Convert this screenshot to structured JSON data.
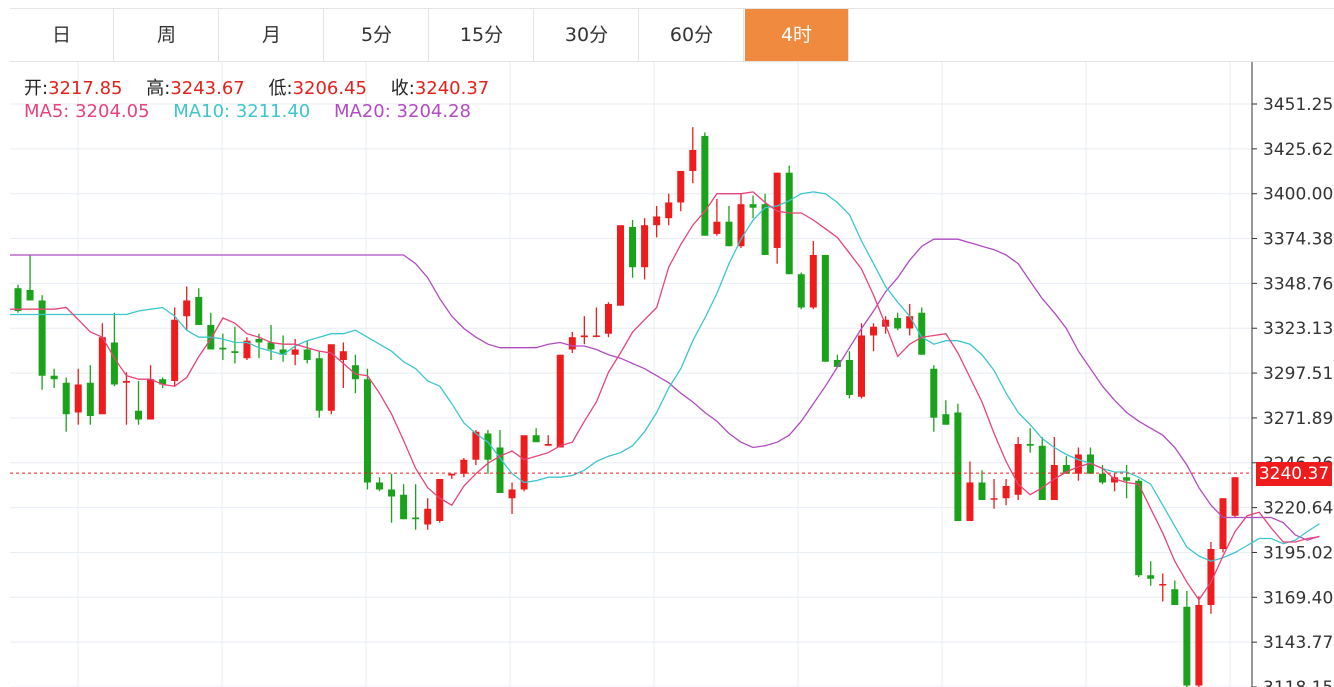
{
  "tabs": [
    {
      "label": "日",
      "active": false
    },
    {
      "label": "周",
      "active": false
    },
    {
      "label": "月",
      "active": false
    },
    {
      "label": "5分",
      "active": false
    },
    {
      "label": "15分",
      "active": false
    },
    {
      "label": "30分",
      "active": false
    },
    {
      "label": "60分",
      "active": false
    },
    {
      "label": "4时",
      "active": true
    }
  ],
  "ohlc": {
    "open_label": "开:",
    "open": "3217.85",
    "high_label": "高:",
    "high": "3243.67",
    "low_label": "低:",
    "low": "3206.45",
    "close_label": "收:",
    "close": "3240.37"
  },
  "ma": {
    "ma5_label": "MA5:",
    "ma5": "3204.05",
    "ma10_label": "MA10:",
    "ma10": "3211.40",
    "ma20_label": "MA20:",
    "ma20": "3204.28"
  },
  "colors": {
    "up": "#ee1c1c",
    "down": "#1aa31a",
    "ma5": "#e8447a",
    "ma10": "#3ec6cf",
    "ma20": "#b24bc3",
    "accent": "#f08a3e"
  },
  "chart_data": {
    "type": "candlestick",
    "y_ticks": [
      3451.25,
      3425.62,
      3400.0,
      3374.38,
      3348.76,
      3323.13,
      3297.51,
      3271.89,
      3246.26,
      3220.64,
      3195.02,
      3169.4,
      3143.77,
      3118.15
    ],
    "y_tick_labels": [
      "3451.25",
      "3425.62",
      "3400.00",
      "3374.38",
      "3348.76",
      "3323.13",
      "3297.51",
      "3271.89",
      "3246.26",
      "3220.64",
      "3195.02",
      "3169.40",
      "3143.77",
      "3118.15"
    ],
    "ylim": [
      3115,
      3475
    ],
    "current_price": 3240.37,
    "current_price_label": "3240.37",
    "candles": [
      [
        3346,
        3348,
        3332,
        3333
      ],
      [
        3345,
        3365,
        3345,
        3339
      ],
      [
        3339,
        3342,
        3288,
        3296
      ],
      [
        3296,
        3300,
        3289,
        3294
      ],
      [
        3292,
        3295,
        3264,
        3274
      ],
      [
        3275,
        3300,
        3268,
        3291
      ],
      [
        3292,
        3302,
        3268,
        3273
      ],
      [
        3274,
        3326,
        3274,
        3318
      ],
      [
        3315,
        3332,
        3290,
        3291
      ],
      [
        3292,
        3298,
        3268,
        3293
      ],
      [
        3276,
        3293,
        3268,
        3271
      ],
      [
        3271,
        3302,
        3271,
        3294
      ],
      [
        3294,
        3295,
        3289,
        3291
      ],
      [
        3293,
        3335,
        3290,
        3328
      ],
      [
        3330,
        3347,
        3322,
        3339
      ],
      [
        3341,
        3346,
        3326,
        3325
      ],
      [
        3325,
        3332,
        3312,
        3311
      ],
      [
        3312,
        3320,
        3305,
        3311
      ],
      [
        3310,
        3324,
        3303,
        3309
      ],
      [
        3306,
        3318,
        3305,
        3316
      ],
      [
        3317,
        3320,
        3306,
        3315
      ],
      [
        3315,
        3325,
        3305,
        3311
      ],
      [
        3311,
        3319,
        3304,
        3308
      ],
      [
        3308,
        3317,
        3302,
        3311
      ],
      [
        3311,
        3316,
        3303,
        3305
      ],
      [
        3306,
        3310,
        3272,
        3276
      ],
      [
        3276,
        3313,
        3274,
        3314
      ],
      [
        3305,
        3315,
        3289,
        3310
      ],
      [
        3302,
        3308,
        3286,
        3294
      ],
      [
        3294,
        3300,
        3231,
        3235
      ],
      [
        3235,
        3238,
        3230,
        3231
      ],
      [
        3231,
        3240,
        3212,
        3227
      ],
      [
        3228,
        3234,
        3214,
        3214
      ],
      [
        3215,
        3234,
        3208,
        3214
      ],
      [
        3211,
        3226,
        3208,
        3220
      ],
      [
        3213,
        3228,
        3212,
        3237
      ],
      [
        3239,
        3240,
        3237,
        3240
      ],
      [
        3240,
        3249,
        3238,
        3248
      ],
      [
        3248,
        3265,
        3245,
        3264
      ],
      [
        3263,
        3265,
        3240,
        3248
      ],
      [
        3255,
        3265,
        3240,
        3229
      ],
      [
        3226,
        3235,
        3217,
        3231
      ],
      [
        3231,
        3255,
        3230,
        3262
      ],
      [
        3262,
        3266,
        3260,
        3258
      ],
      [
        3256,
        3262,
        3256,
        3257
      ],
      [
        3255,
        3308,
        3255,
        3308
      ],
      [
        3311,
        3321,
        3309,
        3318
      ],
      [
        3318,
        3330,
        3314,
        3319
      ],
      [
        3319,
        3335,
        3318,
        3319
      ],
      [
        3320,
        3338,
        3318,
        3337
      ],
      [
        3336,
        3353,
        3336,
        3382
      ],
      [
        3381,
        3385,
        3352,
        3358
      ],
      [
        3358,
        3386,
        3351,
        3382
      ],
      [
        3382,
        3393,
        3375,
        3387
      ],
      [
        3386,
        3400,
        3382,
        3395
      ],
      [
        3395,
        3412,
        3390,
        3413
      ],
      [
        3413,
        3438,
        3406,
        3425
      ],
      [
        3433,
        3435,
        3376,
        3376
      ],
      [
        3377,
        3397,
        3376,
        3384
      ],
      [
        3384,
        3393,
        3370,
        3370
      ],
      [
        3370,
        3400,
        3369,
        3394
      ],
      [
        3394,
        3399,
        3386,
        3392
      ],
      [
        3394,
        3400,
        3369,
        3365
      ],
      [
        3369,
        3412,
        3360,
        3412
      ],
      [
        3412,
        3416,
        3354,
        3354
      ],
      [
        3354,
        3355,
        3334,
        3335
      ],
      [
        3335,
        3373,
        3334,
        3365
      ],
      [
        3365,
        3365,
        3304,
        3304
      ],
      [
        3305,
        3308,
        3303,
        3301
      ],
      [
        3305,
        3310,
        3283,
        3285
      ],
      [
        3284,
        3326,
        3283,
        3319
      ],
      [
        3319,
        3326,
        3310,
        3324
      ],
      [
        3324,
        3330,
        3320,
        3328
      ],
      [
        3329,
        3332,
        3322,
        3323
      ],
      [
        3323,
        3337,
        3319,
        3330
      ],
      [
        3332,
        3335,
        3308,
        3308
      ],
      [
        3300,
        3302,
        3264,
        3272
      ],
      [
        3274,
        3282,
        3268,
        3268
      ],
      [
        3275,
        3280,
        3214,
        3213
      ],
      [
        3213,
        3247,
        3214,
        3235
      ],
      [
        3235,
        3242,
        3226,
        3225
      ],
      [
        3226,
        3237,
        3220,
        3226
      ],
      [
        3226,
        3237,
        3222,
        3233
      ],
      [
        3228,
        3261,
        3225,
        3257
      ],
      [
        3257,
        3266,
        3252,
        3256
      ],
      [
        3256,
        3261,
        3225,
        3225
      ],
      [
        3225,
        3261,
        3225,
        3245
      ],
      [
        3245,
        3250,
        3240,
        3240
      ],
      [
        3240,
        3255,
        3236,
        3251
      ],
      [
        3251,
        3255,
        3240,
        3240
      ],
      [
        3240,
        3245,
        3234,
        3235
      ],
      [
        3235,
        3240,
        3230,
        3238
      ],
      [
        3238,
        3245,
        3226,
        3236
      ],
      [
        3236,
        3237,
        3181,
        3182
      ],
      [
        3182,
        3190,
        3176,
        3180
      ],
      [
        3177,
        3183,
        3167,
        3177
      ],
      [
        3174,
        3179,
        3165,
        3165
      ],
      [
        3164,
        3173,
        3114,
        3119
      ],
      [
        3119,
        3170,
        3111,
        3165
      ],
      [
        3165,
        3201,
        3160,
        3197
      ],
      [
        3197,
        3226,
        3195,
        3226
      ],
      [
        3216,
        3238,
        3215,
        3238
      ],
      [
        3236,
        3251,
        3222,
        3222
      ],
      [
        3225,
        3232,
        3211,
        3218
      ],
      [
        3218,
        3230,
        3203,
        3208
      ],
      [
        3208,
        3216,
        3158,
        3180
      ],
      [
        3180,
        3197,
        3165,
        3189
      ],
      [
        3190,
        3203,
        3188,
        3201
      ],
      [
        3217.85,
        3243.67,
        3206.45,
        3240.37
      ]
    ],
    "ma5": [
      3334,
      3335,
      3328,
      3321,
      3318,
      3306,
      3296,
      3294,
      3294,
      3291,
      3290,
      3295,
      3307,
      3317,
      3329,
      3326,
      3320,
      3318,
      3315,
      3314,
      3314,
      3312,
      3310,
      3309,
      3303,
      3297,
      3296,
      3286,
      3274,
      3259,
      3243,
      3232,
      3226,
      3222,
      3233,
      3240,
      3246,
      3250,
      3253,
      3248,
      3250,
      3252,
      3256,
      3258,
      3270,
      3281,
      3298,
      3309,
      3321,
      3328,
      3335,
      3358,
      3371,
      3382,
      3390,
      3400,
      3400,
      3400,
      3401,
      3395,
      3390,
      3389,
      3389,
      3385,
      3380,
      3375,
      3366,
      3357,
      3342,
      3325,
      3307,
      3314,
      3318,
      3319,
      3320,
      3309,
      3295,
      3281,
      3263,
      3247,
      3234,
      3228,
      3232,
      3237,
      3241,
      3244,
      3246,
      3243,
      3237,
      3235,
      3234,
      3220,
      3206,
      3190,
      3178,
      3168,
      3178,
      3193,
      3207,
      3216,
      3218,
      3209,
      3201,
      3201,
      3203,
      3204.05
    ],
    "ma10": [
      3331,
      3333,
      3334,
      3335,
      3330,
      3322,
      3318,
      3318,
      3317,
      3315,
      3315,
      3312,
      3310,
      3308,
      3313,
      3316,
      3318,
      3320,
      3320,
      3322,
      3318,
      3314,
      3310,
      3304,
      3300,
      3293,
      3290,
      3280,
      3269,
      3263,
      3258,
      3249,
      3240,
      3235,
      3236,
      3238,
      3238,
      3239,
      3242,
      3247,
      3250,
      3252,
      3256,
      3264,
      3275,
      3289,
      3300,
      3316,
      3329,
      3343,
      3360,
      3374,
      3385,
      3392,
      3393,
      3396,
      3400,
      3401,
      3400,
      3395,
      3388,
      3373,
      3360,
      3347,
      3338,
      3330,
      3318,
      3314,
      3316,
      3316,
      3314,
      3308,
      3299,
      3286,
      3275,
      3268,
      3260,
      3255,
      3251,
      3248,
      3246,
      3243,
      3241,
      3241,
      3238,
      3234,
      3222,
      3210,
      3198,
      3193,
      3190,
      3192,
      3195,
      3199,
      3203,
      3203,
      3200,
      3202,
      3207,
      3211.4
    ],
    "ma20": [
      3365,
      3360,
      3352,
      3340,
      3330,
      3323,
      3318,
      3314,
      3312,
      3312,
      3312,
      3312,
      3314,
      3315,
      3313,
      3313,
      3311,
      3308,
      3306,
      3303,
      3300,
      3296,
      3292,
      3286,
      3281,
      3275,
      3270,
      3263,
      3258,
      3255,
      3256,
      3258,
      3262,
      3270,
      3280,
      3290,
      3301,
      3312,
      3323,
      3333,
      3344,
      3352,
      3362,
      3370,
      3374,
      3374,
      3374,
      3372,
      3370,
      3368,
      3365,
      3360,
      3350,
      3340,
      3332,
      3323,
      3310,
      3300,
      3290,
      3282,
      3275,
      3270,
      3266,
      3262,
      3255,
      3245,
      3232,
      3222,
      3215,
      3215,
      3215,
      3215,
      3215,
      3212,
      3205,
      3202,
      3204.28
    ]
  }
}
